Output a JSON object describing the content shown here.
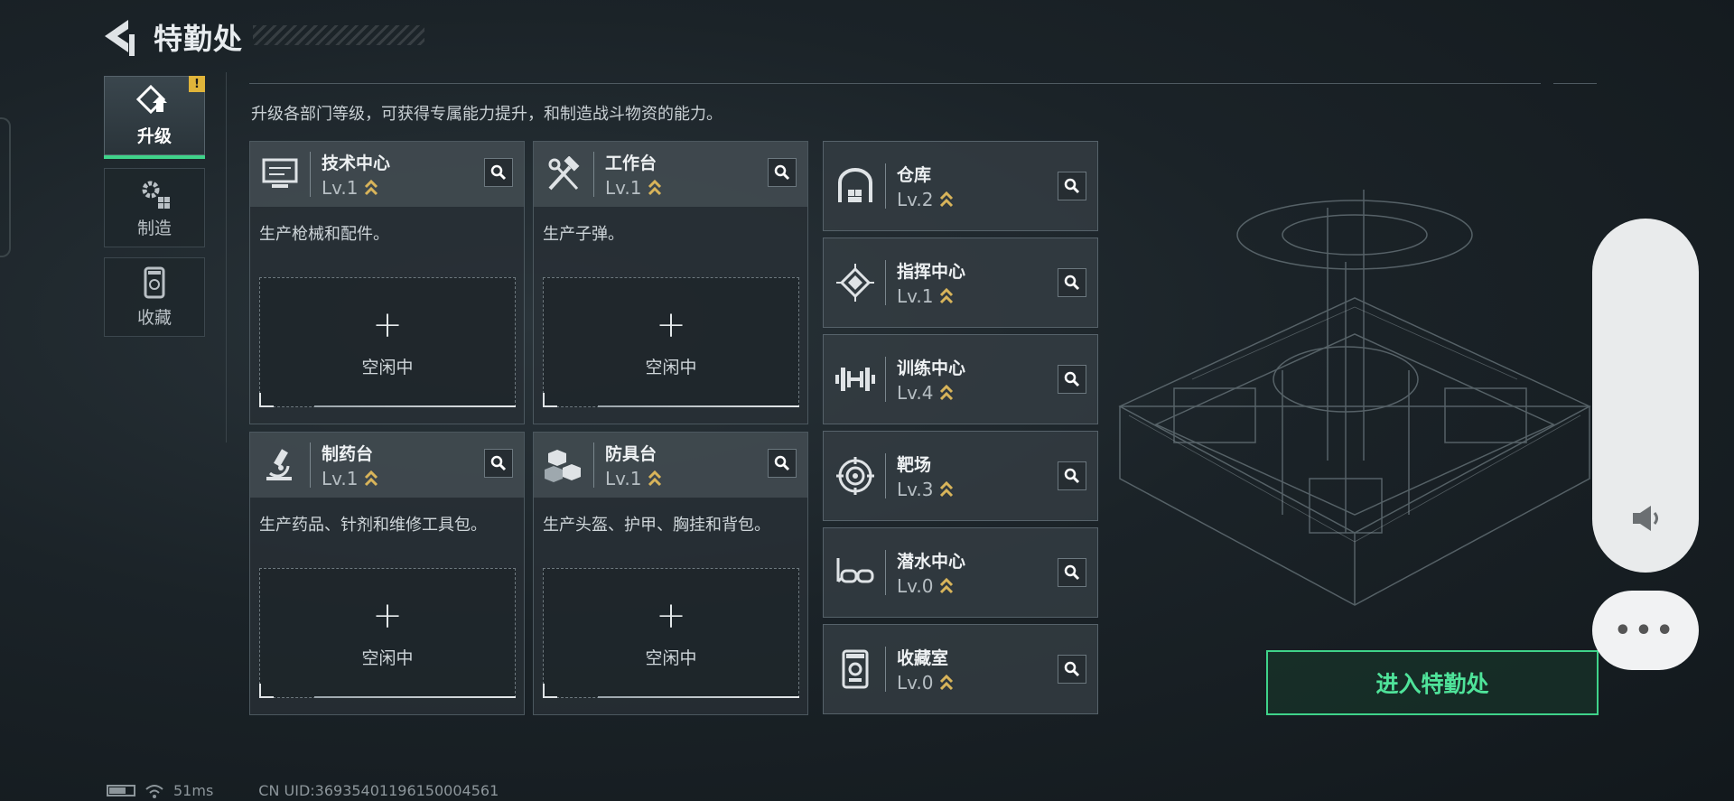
{
  "header": {
    "title": "特勤处"
  },
  "nav": {
    "items": [
      {
        "label": "升级",
        "icon": "upgrade-icon",
        "active": true,
        "badge": "!"
      },
      {
        "label": "制造",
        "icon": "gears-icon",
        "active": false
      },
      {
        "label": "收藏",
        "icon": "collection-icon",
        "active": false
      }
    ]
  },
  "description": "升级各部门等级，可获得专属能力提升，和制造战斗物资的能力。",
  "workstations": [
    {
      "name": "技术中心",
      "level": "Lv.1",
      "desc": "生产枪械和配件。",
      "slot_plus": "+",
      "slot_status": "空闲中",
      "icon": "monitor-icon"
    },
    {
      "name": "工作台",
      "level": "Lv.1",
      "desc": "生产子弹。",
      "slot_plus": "+",
      "slot_status": "空闲中",
      "icon": "tools-icon"
    },
    {
      "name": "制药台",
      "level": "Lv.1",
      "desc": "生产药品、针剂和维修工具包。",
      "slot_plus": "+",
      "slot_status": "空闲中",
      "icon": "microscope-icon"
    },
    {
      "name": "防具台",
      "level": "Lv.1",
      "desc": "生产头盔、护甲、胸挂和背包。",
      "slot_plus": "+",
      "slot_status": "空闲中",
      "icon": "cubes-icon"
    }
  ],
  "facilities": [
    {
      "name": "仓库",
      "level": "Lv.2",
      "icon": "warehouse-icon"
    },
    {
      "name": "指挥中心",
      "level": "Lv.1",
      "icon": "chip-icon"
    },
    {
      "name": "训练中心",
      "level": "Lv.4",
      "icon": "dumbbell-icon"
    },
    {
      "name": "靶场",
      "level": "Lv.3",
      "icon": "target-icon"
    },
    {
      "name": "潜水中心",
      "level": "Lv.0",
      "icon": "diving-mask-icon"
    },
    {
      "name": "收藏室",
      "level": "Lv.0",
      "icon": "trophy-case-icon"
    }
  ],
  "enter_button": "进入特勤处",
  "status": {
    "ping": "51ms",
    "uid": "CN UID:369354011961500045​61"
  },
  "colors": {
    "accent_green": "#3fd38a",
    "gold": "#d8b45a",
    "warning": "#e0b43a"
  }
}
